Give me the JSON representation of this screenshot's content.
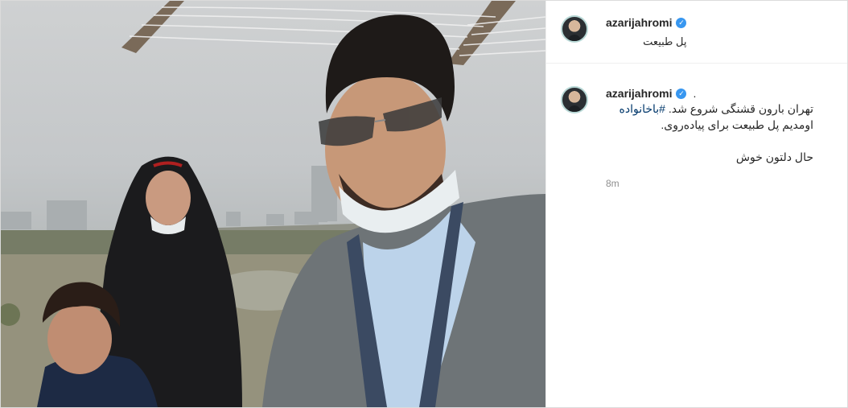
{
  "post": {
    "author": {
      "username": "azarijahromi",
      "verified": true,
      "avatar_icon": "profile-avatar"
    },
    "location": "پل طبیعت",
    "caption": {
      "lead": ".",
      "line1_text": "تهران بارون قشنگی شروع شد. ",
      "line1_hashtag": "#باخانواده",
      "line2": "اومدیم پل طبیعت برای پیاده‌روی.",
      "line3": "حال دلتون خوش"
    },
    "time": "8m"
  },
  "colors": {
    "link": "#00376b",
    "verified": "#3897f0",
    "muted": "#8e8e8e",
    "border": "#dbdbdb"
  }
}
